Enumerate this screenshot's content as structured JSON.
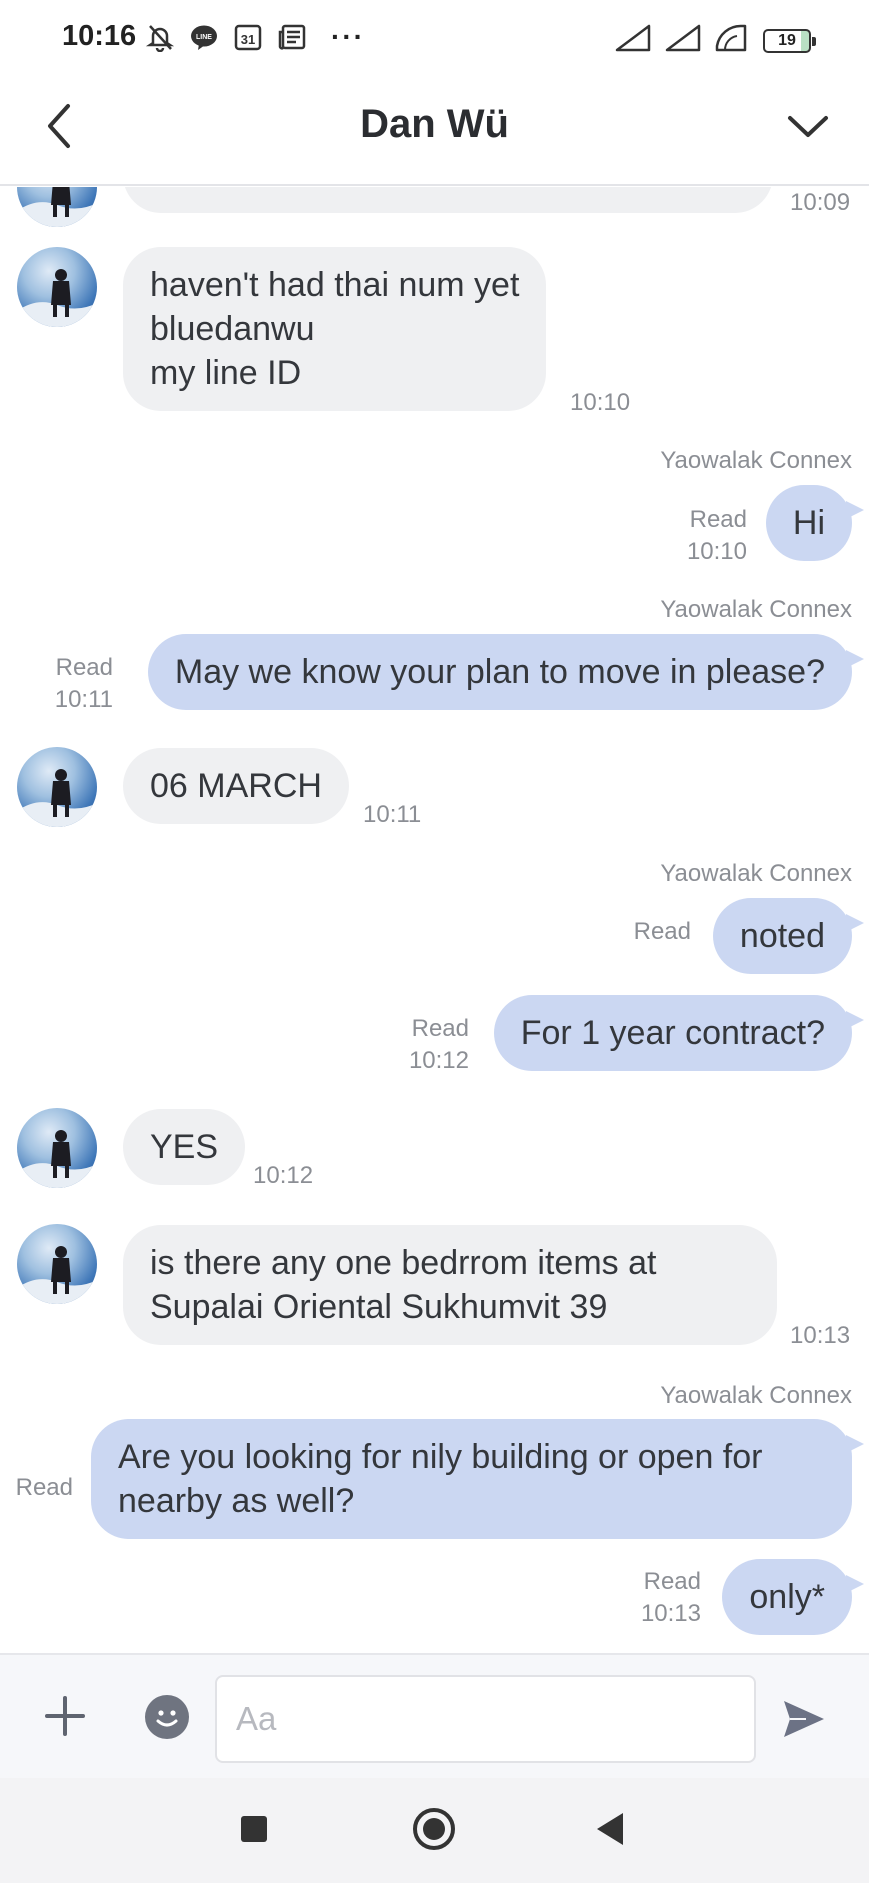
{
  "status_bar": {
    "time": "10:16",
    "icons_left": [
      "muted-bell-icon",
      "line-app-icon",
      "calendar-icon",
      "news-icon"
    ],
    "calendar_day": "31",
    "more": "···",
    "icons_right": [
      "signal-icon",
      "signal-icon",
      "wifi-icon"
    ],
    "battery": "19"
  },
  "header": {
    "title": "Dan Wü",
    "back_icon": "chevron-left-icon",
    "menu_icon": "chevron-down-icon"
  },
  "messages": [
    {
      "dir": "in",
      "partial": true,
      "time": "10:09"
    },
    {
      "dir": "in",
      "lines": [
        "haven't had thai num yet",
        "bluedanwu",
        "my line ID"
      ],
      "time": "10:10"
    },
    {
      "dir": "out",
      "sender": "Yaowalak Connex",
      "text": "Hi",
      "status": "Read",
      "time": "10:10"
    },
    {
      "dir": "out",
      "sender": "Yaowalak Connex",
      "text": "May we know your plan to move in please?",
      "status": "Read",
      "time": "10:11"
    },
    {
      "dir": "in",
      "text": "06 MARCH",
      "time": "10:11"
    },
    {
      "dir": "out",
      "sender": "Yaowalak Connex",
      "text": "noted",
      "status": "Read"
    },
    {
      "dir": "out",
      "text": "For 1 year contract?",
      "status": "Read",
      "time": "10:12"
    },
    {
      "dir": "in",
      "text": "YES",
      "time": "10:12"
    },
    {
      "dir": "in",
      "lines": [
        "is there any one bedrrom items at",
        "Supalai Oriental Sukhumvit 39"
      ],
      "time": "10:13"
    },
    {
      "dir": "out",
      "sender": "Yaowalak Connex",
      "lines": [
        "Are you looking for nily building or open for",
        "nearby as well?"
      ],
      "status": "Read"
    },
    {
      "dir": "out",
      "text": "only*",
      "status": "Read",
      "time": "10:13"
    }
  ],
  "input_bar": {
    "placeholder": "Aa",
    "add_icon": "plus-icon",
    "emoji_icon": "smiley-icon",
    "send_icon": "send-icon"
  },
  "colors": {
    "incoming_bubble": "#eff0f2",
    "outgoing_bubble": "#cbd7f2",
    "meta_text": "#8b8e94"
  }
}
